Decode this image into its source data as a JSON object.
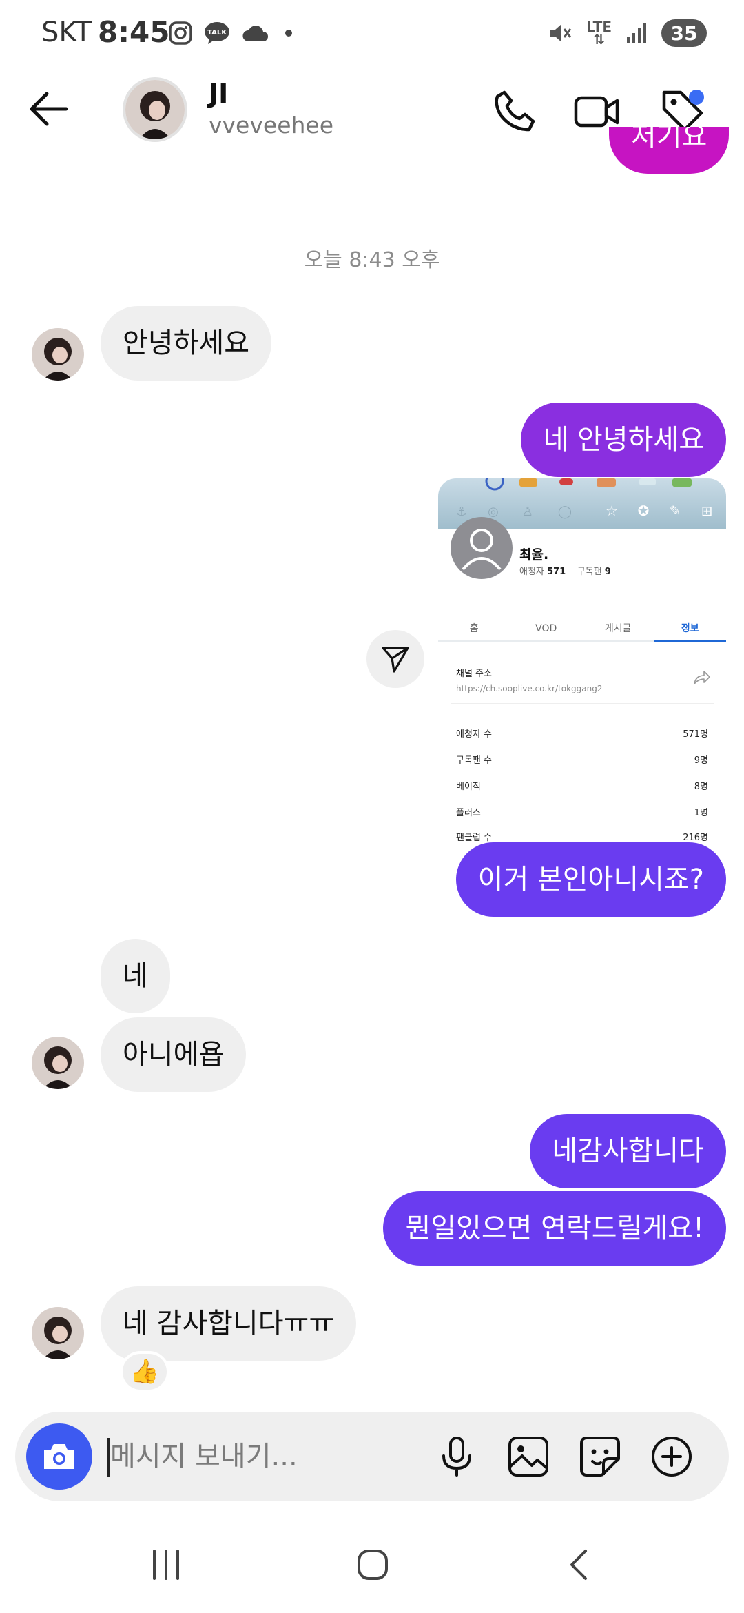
{
  "status_bar": {
    "carrier": "SKT",
    "time": "8:45",
    "network": "LTE",
    "battery": "35"
  },
  "header": {
    "name": "JI",
    "username": "vveveehee"
  },
  "colors": {
    "accent": "#3d5af1",
    "bubble_magenta": "#c614c2",
    "bubble_violet": "#8a2fe0",
    "bubble_blue": "#6a3cf0",
    "incoming_bubble": "#efefef"
  },
  "messages": {
    "top_partial": "저기요",
    "timestamp": "오늘 8:43 오후",
    "m1": "안녕하세요",
    "m2": "네 안녕하세요",
    "m3": "이거 본인아니시죠?",
    "m4": "네",
    "m5": "아니에욥",
    "m6": "네감사합니다",
    "m7": "뭔일있으면 연락드릴게요!",
    "m8": "네 감사합니다ㅠㅠ",
    "reaction": "👍"
  },
  "shared_card": {
    "channel_name": "최율.",
    "viewers_label": "애청자",
    "viewers_value": "571",
    "subscribers_label": "구독팬",
    "subscribers_value": "9",
    "tabs": [
      "홈",
      "VOD",
      "게시글",
      "정보"
    ],
    "address_label": "채널 주소",
    "address_url": "https://ch.sooplive.co.kr/tokggang2",
    "rows": [
      {
        "label": "애청자 수",
        "value": "571명"
      },
      {
        "label": "구독팬 수",
        "value": "9명"
      },
      {
        "label": "베이직",
        "value": "8명"
      },
      {
        "label": "플러스",
        "value": "1명"
      },
      {
        "label": "팬클럽 수",
        "value": "216명"
      }
    ]
  },
  "composer": {
    "placeholder": "메시지 보내기..."
  },
  "icons": {
    "back": "arrow-left",
    "call": "phone",
    "video": "video-camera",
    "tag": "tag",
    "camera": "camera",
    "mic": "microphone",
    "gallery": "image",
    "sticker": "sticker",
    "add": "plus-circle"
  }
}
